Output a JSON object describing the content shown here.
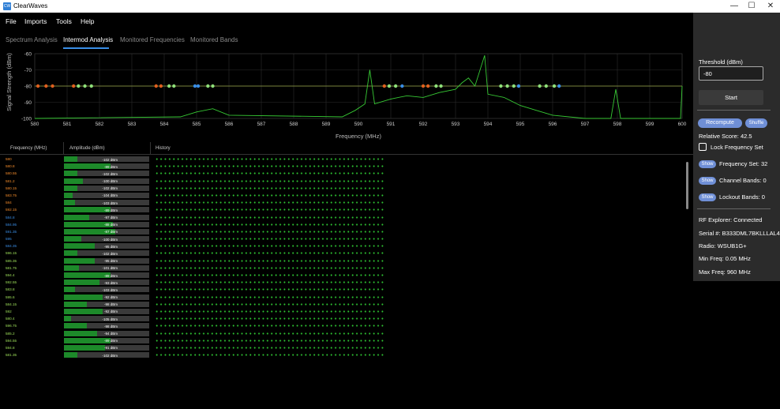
{
  "window": {
    "title": "ClearWaves",
    "icon_text": "CW",
    "minimize": "—",
    "maximize": "☐",
    "close": "✕"
  },
  "menu": [
    "File",
    "Imports",
    "Tools",
    "Help"
  ],
  "tabs": [
    "Spectrum Analysis",
    "Intermod Analysis",
    "Monitored Frequencies",
    "Monitored Bands"
  ],
  "active_tab": "Intermod Analysis",
  "chart_data": {
    "type": "line",
    "xlabel": "Frequency (MHz)",
    "ylabel": "Signal Strength (dBm)",
    "xlim": [
      580,
      600
    ],
    "ylim": [
      -100,
      -60
    ],
    "x_ticks": [
      "580",
      "581",
      "582",
      "583",
      "584",
      "585",
      "586",
      "587",
      "588",
      "589",
      "590",
      "591",
      "592",
      "593",
      "594",
      "595",
      "596",
      "597",
      "598",
      "599",
      "600"
    ],
    "y_ticks": [
      "-60",
      "-70",
      "-80",
      "-90",
      "-100"
    ],
    "threshold_dbm": -80,
    "marker_level_dbm": -80,
    "markers": [
      {
        "f": 580.1,
        "c": "#e0601f"
      },
      {
        "f": 580.35,
        "c": "#e0601f"
      },
      {
        "f": 580.55,
        "c": "#e0601f"
      },
      {
        "f": 581.2,
        "c": "#e0601f"
      },
      {
        "f": 581.35,
        "c": "#8fe07a"
      },
      {
        "f": 581.55,
        "c": "#8fe07a"
      },
      {
        "f": 581.75,
        "c": "#8fe07a"
      },
      {
        "f": 583.75,
        "c": "#e0601f"
      },
      {
        "f": 583.9,
        "c": "#e0601f"
      },
      {
        "f": 584.15,
        "c": "#8fe07a"
      },
      {
        "f": 584.3,
        "c": "#8fe07a"
      },
      {
        "f": 584.95,
        "c": "#3a8ee6"
      },
      {
        "f": 585.05,
        "c": "#3a8ee6"
      },
      {
        "f": 585.35,
        "c": "#8fe07a"
      },
      {
        "f": 585.5,
        "c": "#8fe07a"
      },
      {
        "f": 590.8,
        "c": "#e0601f"
      },
      {
        "f": 590.95,
        "c": "#8fe07a"
      },
      {
        "f": 591.15,
        "c": "#8fe07a"
      },
      {
        "f": 591.35,
        "c": "#3a8ee6"
      },
      {
        "f": 592.0,
        "c": "#e0601f"
      },
      {
        "f": 592.15,
        "c": "#e0601f"
      },
      {
        "f": 592.4,
        "c": "#8fe07a"
      },
      {
        "f": 592.55,
        "c": "#8fe07a"
      },
      {
        "f": 594.4,
        "c": "#8fe07a"
      },
      {
        "f": 594.6,
        "c": "#8fe07a"
      },
      {
        "f": 594.8,
        "c": "#8fe07a"
      },
      {
        "f": 594.95,
        "c": "#3a8ee6"
      },
      {
        "f": 595.6,
        "c": "#8fe07a"
      },
      {
        "f": 595.8,
        "c": "#8fe07a"
      },
      {
        "f": 596.05,
        "c": "#8fe07a"
      },
      {
        "f": 596.2,
        "c": "#3a8ee6"
      }
    ],
    "series": [
      {
        "values": [
          [
            580,
            -100
          ],
          [
            584.5,
            -99
          ],
          [
            585,
            -96
          ],
          [
            585.5,
            -94
          ],
          [
            586,
            -98
          ],
          [
            589.5,
            -99
          ],
          [
            589.9,
            -95
          ],
          [
            590.2,
            -91
          ],
          [
            590.35,
            -70
          ],
          [
            590.5,
            -91
          ],
          [
            591,
            -88
          ],
          [
            591.5,
            -86
          ],
          [
            592,
            -87
          ],
          [
            592.5,
            -84
          ],
          [
            593,
            -82
          ],
          [
            593.2,
            -78
          ],
          [
            593.4,
            -75
          ],
          [
            593.6,
            -80
          ],
          [
            593.9,
            -61
          ],
          [
            594,
            -85
          ],
          [
            594.5,
            -87
          ],
          [
            595,
            -92
          ],
          [
            595.5,
            -95
          ],
          [
            596,
            -98
          ],
          [
            597,
            -100
          ],
          [
            597.8,
            -100
          ],
          [
            597.95,
            -82
          ],
          [
            598.1,
            -100
          ],
          [
            599,
            -100
          ],
          [
            599.95,
            -100
          ],
          [
            600,
            -80
          ]
        ]
      }
    ]
  },
  "table": {
    "headers": [
      "Frequency (MHz)",
      "Amplitude (dBm)",
      "History"
    ],
    "rows": [
      {
        "freq": "580",
        "amp": "-102 dBm",
        "level": 0.16,
        "color": "#f08a2a"
      },
      {
        "freq": "580.8",
        "amp": "-89 dBm",
        "level": 0.55,
        "color": "#f08a2a"
      },
      {
        "freq": "580.55",
        "amp": "-102 dBm",
        "level": 0.16,
        "color": "#f08a2a"
      },
      {
        "freq": "581.2",
        "amp": "-100 dBm",
        "level": 0.22,
        "color": "#f08a2a"
      },
      {
        "freq": "580.15",
        "amp": "-102 dBm",
        "level": 0.16,
        "color": "#f08a2a"
      },
      {
        "freq": "583.75",
        "amp": "-104 dBm",
        "level": 0.1,
        "color": "#f08a2a"
      },
      {
        "freq": "584",
        "amp": "-103 dBm",
        "level": 0.13,
        "color": "#f08a2a"
      },
      {
        "freq": "592.15",
        "amp": "-89 dBm",
        "level": 0.55,
        "color": "#f08a2a"
      },
      {
        "freq": "584.8",
        "amp": "-97 dBm",
        "level": 0.3,
        "color": "#3a8ee6"
      },
      {
        "freq": "584.95",
        "amp": "-88 dBm",
        "level": 0.57,
        "color": "#3a8ee6"
      },
      {
        "freq": "591.35",
        "amp": "-87 dBm",
        "level": 0.6,
        "color": "#3a8ee6"
      },
      {
        "freq": "595",
        "amp": "-100 dBm",
        "level": 0.2,
        "color": "#3a8ee6"
      },
      {
        "freq": "584.35",
        "amp": "-95 dBm",
        "level": 0.36,
        "color": "#3a8ee6"
      },
      {
        "freq": "596.15",
        "amp": "-102 dBm",
        "level": 0.16,
        "color": "#9ee05a"
      },
      {
        "freq": "585.35",
        "amp": "-95 dBm",
        "level": 0.36,
        "color": "#9ee05a"
      },
      {
        "freq": "581.75",
        "amp": "-101 dBm",
        "level": 0.18,
        "color": "#9ee05a"
      },
      {
        "freq": "594.4",
        "amp": "-89 dBm",
        "level": 0.55,
        "color": "#9ee05a"
      },
      {
        "freq": "592.55",
        "amp": "-93 dBm",
        "level": 0.42,
        "color": "#9ee05a"
      },
      {
        "freq": "583.8",
        "amp": "-103 dBm",
        "level": 0.13,
        "color": "#9ee05a"
      },
      {
        "freq": "595.6",
        "amp": "-92 dBm",
        "level": 0.45,
        "color": "#9ee05a"
      },
      {
        "freq": "584.15",
        "amp": "-98 dBm",
        "level": 0.27,
        "color": "#9ee05a"
      },
      {
        "freq": "592",
        "amp": "-92 dBm",
        "level": 0.45,
        "color": "#9ee05a"
      },
      {
        "freq": "580.4",
        "amp": "-105 dBm",
        "level": 0.08,
        "color": "#9ee05a"
      },
      {
        "freq": "596.75",
        "amp": "-98 dBm",
        "level": 0.27,
        "color": "#9ee05a"
      },
      {
        "freq": "585.2",
        "amp": "-94 dBm",
        "level": 0.39,
        "color": "#9ee05a"
      },
      {
        "freq": "594.55",
        "amp": "-89 dBm",
        "level": 0.55,
        "color": "#9ee05a"
      },
      {
        "freq": "594.8",
        "amp": "-91 dBm",
        "level": 0.48,
        "color": "#9ee05a"
      },
      {
        "freq": "581.35",
        "amp": "-102 dBm",
        "level": 0.16,
        "color": "#9ee05a"
      }
    ]
  },
  "panel": {
    "threshold_label": "Threshold (dBm)",
    "threshold_value": "-80",
    "start_label": "Start",
    "recompute_label": "Recompute",
    "shuffle_label": "Shuffle",
    "relative_score": "Relative Score:  42.5",
    "lock_label": "Lock Frequency Set",
    "show_label": "Show",
    "frequency_set": "Frequency Set: 32",
    "channel_bands": "Channel Bands: 0",
    "lockout_bands": "Lockout Bands: 0",
    "rf_explorer": "RF Explorer: Connected",
    "serial": "Serial #:  B333DML7BKLLLAL4",
    "radio": "Radio:   WSUB1G+",
    "min_freq": "Min Freq:  0.05   MHz",
    "max_freq": "Max Freq:  960   MHz"
  }
}
